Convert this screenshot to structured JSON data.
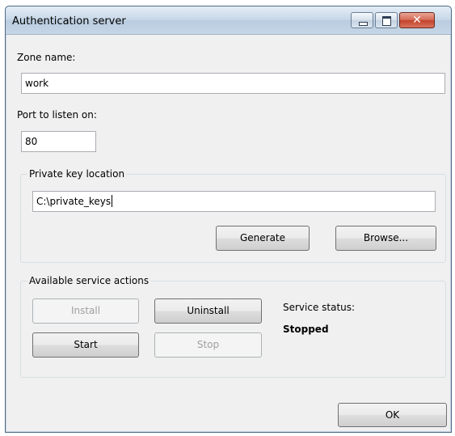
{
  "window": {
    "title": "Authentication server",
    "close_glyph": "✕"
  },
  "zone": {
    "label": "Zone name:",
    "value": "work"
  },
  "port": {
    "label": "Port to listen on:",
    "value": "80"
  },
  "private_key": {
    "group_label": "Private key location",
    "value": "C:\\private_keys",
    "generate_label": "Generate",
    "browse_label": "Browse..."
  },
  "service_actions": {
    "group_label": "Available service actions",
    "install_label": "Install",
    "install_enabled": false,
    "uninstall_label": "Uninstall",
    "uninstall_enabled": true,
    "start_label": "Start",
    "start_enabled": true,
    "stop_label": "Stop",
    "stop_enabled": false,
    "status_label": "Service status:",
    "status_value": "Stopped"
  },
  "footer": {
    "ok_label": "OK"
  },
  "icons": [
    "minimize-icon",
    "maximize-icon",
    "close-icon"
  ]
}
